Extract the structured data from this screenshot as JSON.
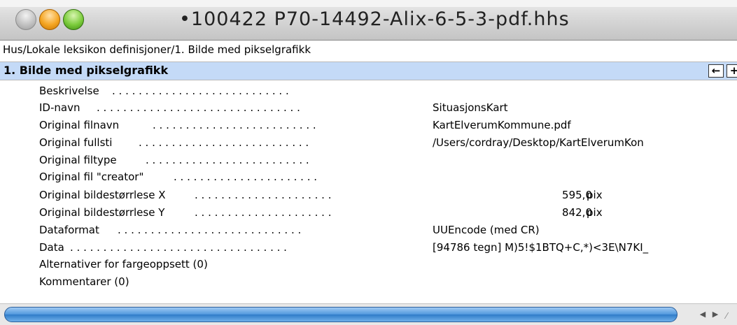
{
  "window": {
    "title": "•100422 P70-14492-Alix-6-5-3-pdf.hhs"
  },
  "breadcrumb": "Hus/Lokale leksikon definisjoner/1. Bilde med pikselgrafikk",
  "section": {
    "title": "1. Bilde med pikselgrafikk",
    "prev_icon": "←",
    "next_icon": "+"
  },
  "fields": [
    {
      "label": "Beskrivelse",
      "dots": ". . . . . . . . . . . . . . . . . . . . . . . . . . .",
      "value": ""
    },
    {
      "label": "ID-navn",
      "dots": ". . . . . . . . . . . . . . . . . . . . . . . . . . . . . . .",
      "value": "SituasjonsKart"
    },
    {
      "label": "Original filnavn",
      "dots": ". . . . . . . . . . . . . . . . . . . . . . . . .",
      "value": "KartElverumKommune.pdf"
    },
    {
      "label": "Original fullsti",
      "dots": ". . . . . . . . . . . . . . . . . . . . . . . . . .",
      "value": "/Users/cordray/Desktop/KartElverumKon"
    },
    {
      "label": "Original filtype",
      "dots": ". . . . . . . . . . . . . . . . . . . . . . . . .",
      "value": ""
    },
    {
      "label": "Original fil \"creator\"",
      "dots": ". . . . . . . . . . . . . . . . . . . . . .",
      "value": ""
    },
    {
      "label": "Original bildestørrlese X",
      "dots": ". . . . . . . . . . . . . . . . . . . . .",
      "value": "",
      "number": "595,0",
      "unit": "pix"
    },
    {
      "label": "Original bildestørrlese Y",
      "dots": ". . . . . . . . . . . . . . . . . . . . .",
      "value": "",
      "number": "842,0",
      "unit": "pix"
    },
    {
      "label": "Dataformat",
      "dots": ". . . . . . . . . . . . . . . . . . . . . . . . . . . .",
      "value": "UUEncode (med CR)"
    },
    {
      "label": "Data",
      "dots": ". . . . . . . . . . . . . . . . . . . . . . . . . . . . . . . . .",
      "value": "[94786 tegn] M)5!$1BTQ+C,*)<3E\\N7KI_"
    }
  ],
  "groups": [
    {
      "label": "Alternativer for fargeoppsett (0)"
    },
    {
      "label": "Kommentarer (0)"
    }
  ],
  "scrollbar": {
    "left_arrow": "◀",
    "right_arrow": "▶",
    "grip": "⁄"
  }
}
